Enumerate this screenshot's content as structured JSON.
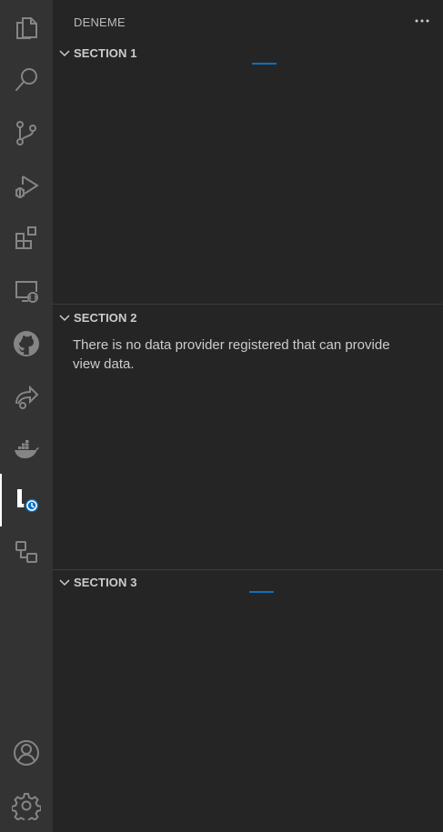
{
  "activity_bar": {
    "items": [
      {
        "name": "explorer-icon"
      },
      {
        "name": "search-icon"
      },
      {
        "name": "source-control-icon"
      },
      {
        "name": "run-debug-icon"
      },
      {
        "name": "extensions-icon"
      },
      {
        "name": "remote-explorer-icon"
      },
      {
        "name": "github-icon"
      },
      {
        "name": "live-share-icon"
      },
      {
        "name": "docker-icon"
      },
      {
        "name": "timeline-view-icon"
      },
      {
        "name": "custom-view-icon"
      }
    ],
    "bottom_items": [
      {
        "name": "accounts-icon"
      },
      {
        "name": "manage-gear-icon"
      }
    ],
    "active_index": 9
  },
  "sidebar": {
    "title": "DENEME",
    "more_actions": "···",
    "sections": [
      {
        "label": "SECTION 1",
        "loading": true,
        "message": ""
      },
      {
        "label": "SECTION 2",
        "loading": false,
        "message": "There is no data provider registered that can provide view data."
      },
      {
        "label": "SECTION 3",
        "loading": true,
        "message": ""
      }
    ]
  },
  "colors": {
    "activity_bar_bg": "#333333",
    "sidebar_bg": "#252526",
    "icon_inactive": "#858585",
    "icon_active": "#ffffff",
    "progress": "#0e70c0",
    "badge": "#0e70c0"
  }
}
